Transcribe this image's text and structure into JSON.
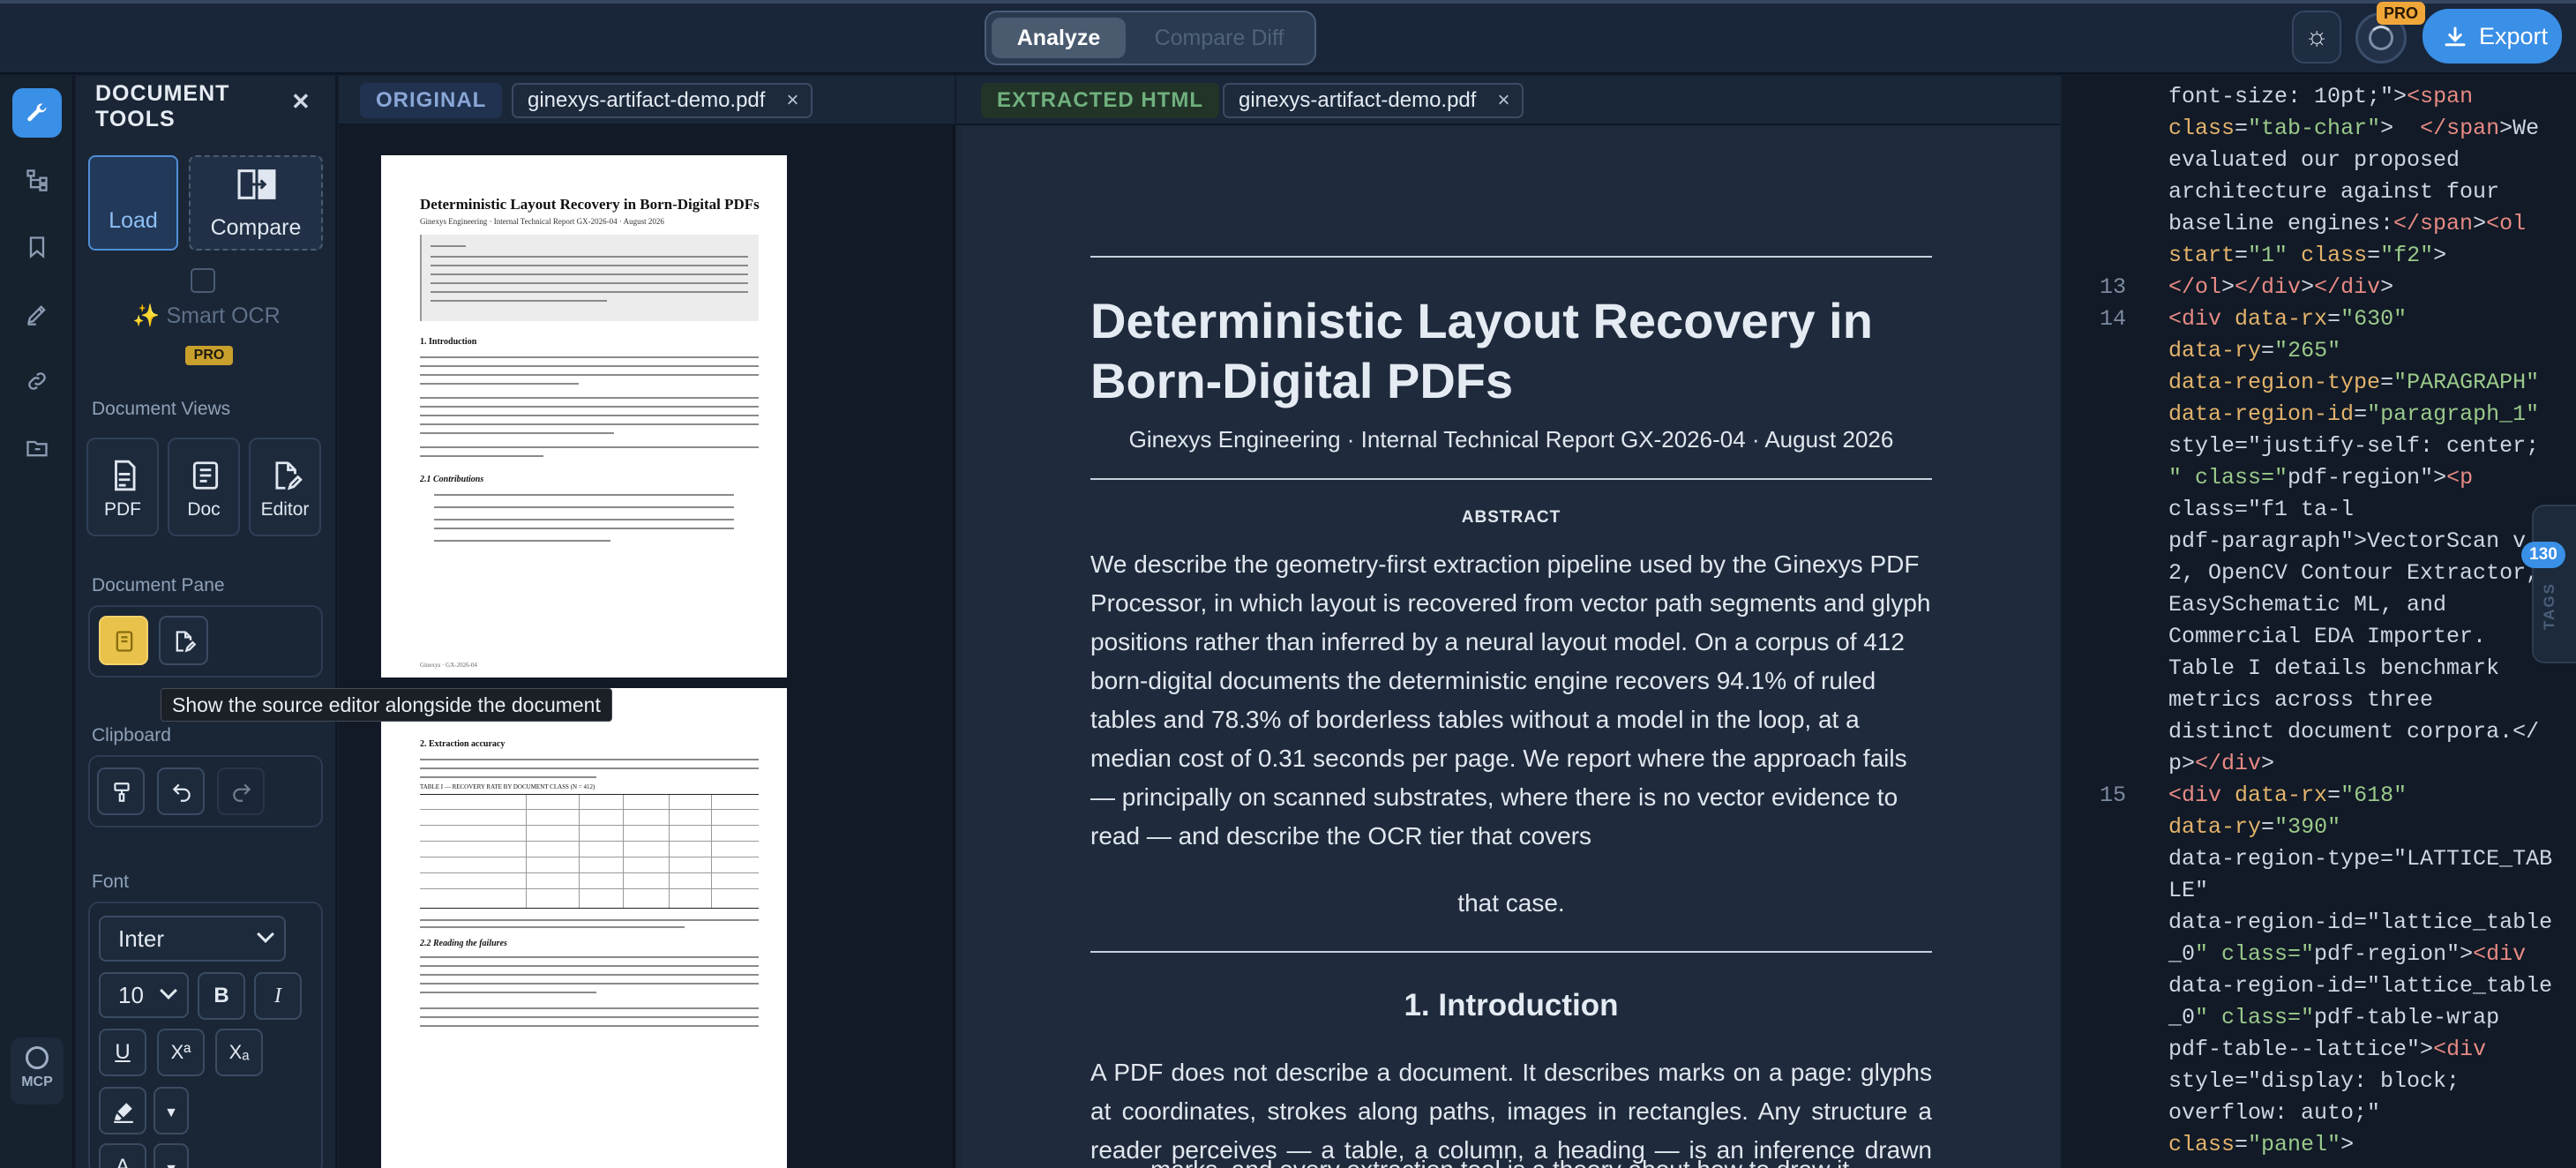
{
  "header": {
    "analyze_label": "Analyze",
    "compare_diff_label": "Compare Diff",
    "pro_badge": "PRO",
    "export_label": "Export"
  },
  "rail": {
    "icons": [
      "wrench-icon",
      "structure-icon",
      "bookmark-icon",
      "edit-icon",
      "link-icon",
      "folder-icon"
    ],
    "mcp_label": "MCP"
  },
  "tools": {
    "title": "DOCUMENT TOOLS",
    "load_label": "Load",
    "compare_label": "Compare",
    "smart_ocr_label": "✨ Smart OCR",
    "smart_ocr_badge": "PRO",
    "document_views_label": "Document Views",
    "views": [
      "PDF",
      "Doc",
      "Editor"
    ],
    "document_pane_label": "Document Pane",
    "tooltip": "Show the source editor alongside the document",
    "clipboard_label": "Clipboard",
    "font_label": "Font",
    "font_family": "Inter",
    "font_size": "10",
    "bold": "B",
    "italic": "I",
    "underline": "U",
    "superscript": "Xª",
    "subscript": "Xₐ",
    "text_color_glyph": "A"
  },
  "original": {
    "tag": "ORIGINAL",
    "file": "ginexys-artifact-demo.pdf",
    "page1": {
      "title": "Deterministic Layout Recovery in Born-Digital PDFs",
      "meta": "Ginexys Engineering · Internal Technical Report GX-2026-04 · August 2026",
      "h_intro": "1. Introduction",
      "h_contrib": "2.1 Contributions",
      "footer": "Ginexys · GX-2026-04"
    },
    "page2": {
      "h_accuracy": "2. Extraction accuracy",
      "caption": "TABLE I — RECOVERY RATE BY DOCUMENT CLASS (N = 412)",
      "h_failures": "2.2 Reading the failures"
    }
  },
  "extracted": {
    "tag": "EXTRACTED HTML",
    "file": "ginexys-artifact-demo.pdf",
    "title": "Deterministic Layout Recovery in Born-Digital PDFs",
    "meta": "Ginexys Engineering · Internal Technical Report GX-2026-04 · August 2026",
    "abstract_heading": "ABSTRACT",
    "abstract": "We describe the geometry-first extraction pipeline used by the Ginexys PDF Processor, in which layout is recovered from vector path segments and glyph positions rather than inferred by a neural layout model. On a corpus of 412 born-digital documents the deterministic engine recovers 94.1% of ruled tables and 78.3% of borderless tables without a model in the loop, at a median cost of 0.31 seconds per page. We report where the approach fails — principally on scanned substrates, where there is no vector evidence to read — and describe the OCR tier that covers",
    "abstract_tail": "that case.",
    "intro_heading": "1. Introduction",
    "intro": "A PDF does not describe a document. It describes marks on a page: glyphs at coordinates, strokes along paths, images in rectangles. Any structure a reader perceives — a table, a column, a heading — is an inference drawn from those",
    "intro_tail": "marks, and every extraction tool is a theory about how to draw it."
  },
  "code": {
    "lines": [
      {
        "n": "",
        "t": "  font-size: 10pt;\"><span"
      },
      {
        "n": "",
        "t": "  class=\"tab-char\">  </span>We"
      },
      {
        "n": "",
        "t": "  evaluated our proposed"
      },
      {
        "n": "",
        "t": "  architecture against four"
      },
      {
        "n": "",
        "t": "  baseline engines:</span><ol"
      },
      {
        "n": "",
        "t": "  start=\"1\" class=\"f2\">"
      },
      {
        "n": "13",
        "t": "  </ol></div></div>"
      },
      {
        "n": "14",
        "t": "  <div data-rx=\"630\""
      },
      {
        "n": "",
        "t": "  data-ry=\"265\""
      },
      {
        "n": "",
        "t": "  data-region-type=\"PARAGRAPH\""
      },
      {
        "n": "",
        "t": "  data-region-id=\"paragraph_1\""
      },
      {
        "n": "",
        "t": "  style=\"justify-self: center;"
      },
      {
        "n": "",
        "t": "  \" class=\"pdf-region\"><p"
      },
      {
        "n": "",
        "t": "  class=\"f1 ta-l"
      },
      {
        "n": "",
        "t": "  pdf-paragraph\">VectorScan v"
      },
      {
        "n": "",
        "t": "  2, OpenCV Contour Extractor,"
      },
      {
        "n": "",
        "t": "  EasySchematic ML, and"
      },
      {
        "n": "",
        "t": "  Commercial EDA Importer."
      },
      {
        "n": "",
        "t": "  Table I details benchmark"
      },
      {
        "n": "",
        "t": "  metrics across three"
      },
      {
        "n": "",
        "t": "  distinct document corpora.</"
      },
      {
        "n": "",
        "t": "  p></div>"
      },
      {
        "n": "15",
        "t": "  <div data-rx=\"618\""
      },
      {
        "n": "",
        "t": "  data-ry=\"390\""
      },
      {
        "n": "",
        "t": "  data-region-type=\"LATTICE_TAB"
      },
      {
        "n": "",
        "t": "  LE\""
      },
      {
        "n": "",
        "t": "  data-region-id=\"lattice_table"
      },
      {
        "n": "",
        "t": "  _0\" class=\"pdf-region\"><div"
      },
      {
        "n": "",
        "t": "  data-region-id=\"lattice_table"
      },
      {
        "n": "",
        "t": "  _0\" class=\"pdf-table-wrap"
      },
      {
        "n": "",
        "t": "  pdf-table--lattice\"><div"
      },
      {
        "n": "",
        "t": "  style=\"display: block;"
      },
      {
        "n": "",
        "t": "  overflow: auto;\""
      },
      {
        "n": "",
        "t": "  class=\"panel\">"
      }
    ],
    "tags_count": "130",
    "tags_label": "TAGS"
  },
  "colors": {
    "accent": "#3a8fe6",
    "pro": "#f0a73a",
    "original_tag": "#89a6d6",
    "extracted_tag": "#6fb07e"
  }
}
